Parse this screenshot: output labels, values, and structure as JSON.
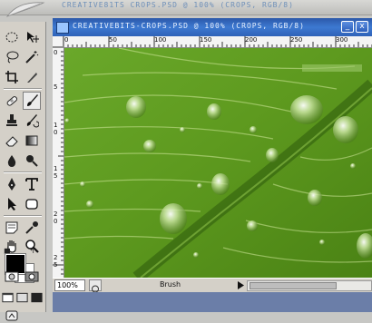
{
  "app": {
    "options_bar_ghost": "CREATIVE81TS  CROPS.PSD  @  100%  (CROPS,  RGB/8)"
  },
  "document": {
    "title": "CREATIVEBITS-CROPS.PSD @ 100% (CROPS, RGB/8)",
    "minimize_label": "_",
    "close_label": "x",
    "zoom_value": "100%",
    "status_text": "Brush",
    "scroll_position_fraction": 0.0
  },
  "ruler_h": [
    "0",
    "50",
    "100",
    "150",
    "200",
    "250",
    "300"
  ],
  "ruler_v": [
    "0",
    "5",
    "1",
    "0",
    "1",
    "5",
    "2",
    "0",
    "2",
    "5"
  ],
  "tools": [
    {
      "name": "marquee-tool",
      "icon": "dashed-ellipse-icon"
    },
    {
      "name": "move-tool",
      "icon": "move-arrow-icon"
    },
    {
      "name": "lasso-tool",
      "icon": "lasso-icon"
    },
    {
      "name": "magic-wand-tool",
      "icon": "magic-wand-icon"
    },
    {
      "name": "crop-tool",
      "icon": "crop-icon"
    },
    {
      "name": "slice-tool",
      "icon": "slice-knife-icon"
    },
    {
      "name": "healing-brush-tool",
      "icon": "bandage-icon"
    },
    {
      "name": "brush-tool",
      "icon": "paintbrush-icon"
    },
    {
      "name": "clone-stamp-tool",
      "icon": "stamp-icon"
    },
    {
      "name": "history-brush-tool",
      "icon": "history-brush-icon"
    },
    {
      "name": "eraser-tool",
      "icon": "eraser-icon"
    },
    {
      "name": "gradient-tool",
      "icon": "gradient-icon"
    },
    {
      "name": "blur-tool",
      "icon": "water-drop-icon"
    },
    {
      "name": "dodge-tool",
      "icon": "dodge-icon"
    },
    {
      "name": "pen-tool",
      "icon": "pen-nib-icon"
    },
    {
      "name": "type-tool",
      "icon": "type-t-icon"
    },
    {
      "name": "path-selection-tool",
      "icon": "arrow-pointer-icon"
    },
    {
      "name": "shape-tool",
      "icon": "rounded-rect-icon"
    },
    {
      "name": "notes-tool",
      "icon": "note-icon"
    },
    {
      "name": "eyedropper-tool",
      "icon": "eyedropper-icon"
    },
    {
      "name": "hand-tool",
      "icon": "hand-icon"
    },
    {
      "name": "zoom-tool",
      "icon": "magnifier-icon"
    }
  ],
  "colors": {
    "foreground": "#000000",
    "background": "#ffffff",
    "titlebar_accent": "#3d79d1",
    "leaf_green": "#5e9a1f"
  }
}
